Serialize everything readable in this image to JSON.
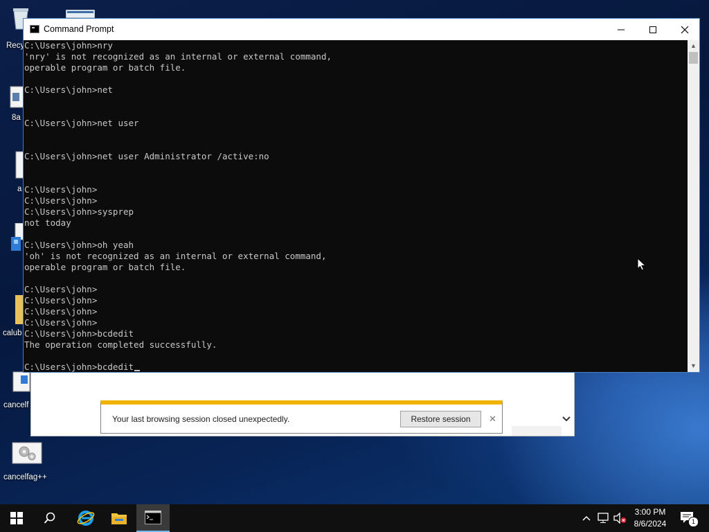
{
  "desktop": {
    "icons": [
      {
        "label": "Recy"
      },
      {
        "label": "8a"
      },
      {
        "label": "a"
      },
      {
        "label": "calub"
      },
      {
        "label": "cancelf"
      },
      {
        "label": "cancelfag++"
      }
    ]
  },
  "cmd": {
    "title": "Command Prompt",
    "buttons": {
      "minimize": "—",
      "maximize": "☐",
      "close": "✕"
    },
    "lines": [
      "C:\\Users\\john>nry",
      "'nry' is not recognized as an internal or external command,",
      "operable program or batch file.",
      "",
      "C:\\Users\\john>net",
      "",
      "",
      "C:\\Users\\john>net user",
      "",
      "",
      "C:\\Users\\john>net user Administrator /active:no",
      "",
      "",
      "C:\\Users\\john>",
      "C:\\Users\\john>",
      "C:\\Users\\john>sysprep",
      "not today",
      "",
      "C:\\Users\\john>oh yeah",
      "'oh' is not recognized as an internal or external command,",
      "operable program or batch file.",
      "",
      "C:\\Users\\john>",
      "C:\\Users\\john>",
      "C:\\Users\\john>",
      "C:\\Users\\john>",
      "C:\\Users\\john>bcdedit",
      "The operation completed successfully.",
      "",
      "C:\\Users\\john>bcdedit"
    ]
  },
  "notification": {
    "message": "Your last browsing session closed unexpectedly.",
    "restore_label": "Restore session",
    "close_glyph": "✕"
  },
  "taskbar": {
    "items": [
      "start",
      "search",
      "internet-explorer",
      "file-explorer",
      "command-prompt"
    ],
    "time": "3:00 PM",
    "date": "8/6/2024",
    "notification_count": "1"
  },
  "colors": {
    "console_bg": "#0c0c0c",
    "console_fg": "#c8c8c8",
    "notification_bar": "#f0b400",
    "taskbar_bg": "#101010"
  }
}
